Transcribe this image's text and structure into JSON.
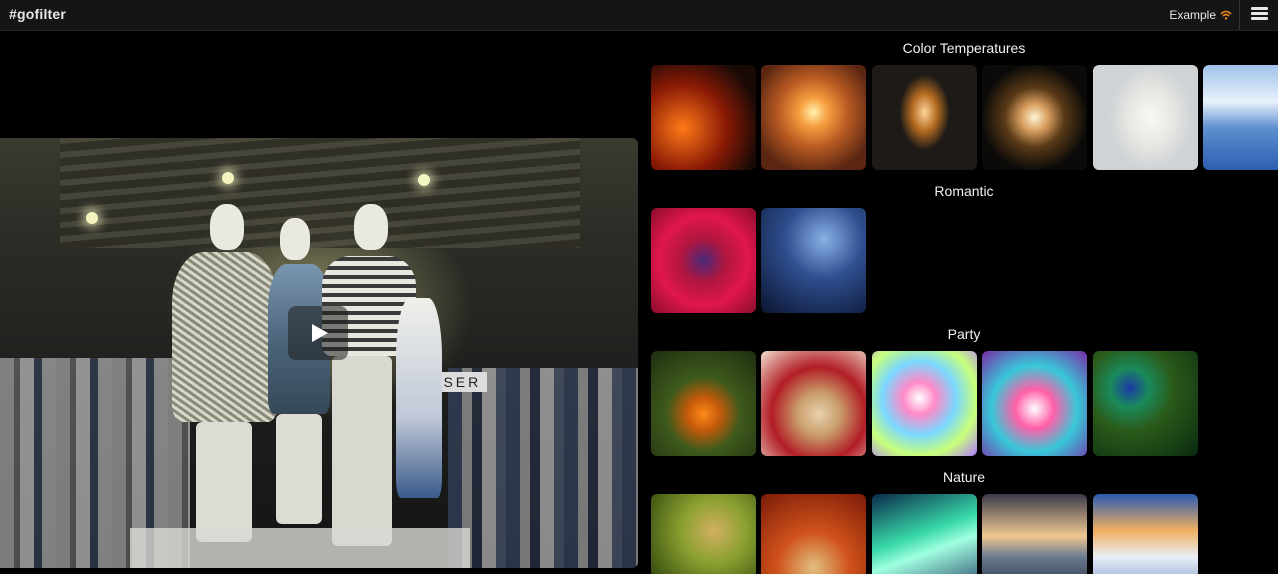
{
  "header": {
    "brand": "#gofilter",
    "example_label": "Example",
    "wifi_icon": "wifi-icon",
    "menu_icon": "hamburger-menu-icon"
  },
  "video": {
    "sign_text": "RESER",
    "play_icon": "play-icon"
  },
  "sections": [
    {
      "title": "Color Temperatures",
      "thumbs": [
        {
          "name": "embers",
          "bg": "radial-gradient(circle at 30% 60%, #ff7a1a, #8a1a05 45%, #1a0a06 80%)"
        },
        {
          "name": "candle",
          "bg": "radial-gradient(circle at 50% 45%, #fff2b0 0%, #f7a040 18%, #b85a22 45%, #5a2612 80%)"
        },
        {
          "name": "lightbulb",
          "bg": "radial-gradient(ellipse 30% 45% at 50% 45%, #ffd59a 0%, #b36a20 40%, #1d1a17 80%)"
        },
        {
          "name": "lamp",
          "bg": "radial-gradient(circle at 50% 50%, #fff3d6 0%, #d9a060 18%, #5a3a18 40%, #0b0a08 72%)"
        },
        {
          "name": "snow-portrait",
          "bg": "radial-gradient(ellipse 40% 50% at 55% 50%, #f8f8f5 0%, #e9e8e3 50%, #cfd3d6 100%)"
        },
        {
          "name": "sky",
          "bg": "linear-gradient(180deg, #9fc2ea 0%, #e9f1fb 35%, #5d8fd0 60%, #2c5fb0 100%)"
        }
      ]
    },
    {
      "title": "Romantic",
      "thumbs": [
        {
          "name": "heart",
          "bg": "radial-gradient(circle at 50% 50%, #4a2a7a 0%, #b1163f 30%, #e0164e 60%, #8a0c2a 100%)"
        },
        {
          "name": "couple-silhouette",
          "bg": "radial-gradient(circle at 60% 30%, #8ab0e6 0%, #2f4f8f 40%, #0b1430 100%)"
        }
      ]
    },
    {
      "title": "Party",
      "thumbs": [
        {
          "name": "pumpkin",
          "bg": "radial-gradient(circle at 50% 60%, #ff8a1a 0%, #c45a0a 20%, #3e5a1c 45%, #1e2e10 100%)"
        },
        {
          "name": "cookies",
          "bg": "radial-gradient(circle at 55% 60%, #e8d2b0 0%, #c99d6a 25%, #b21d26 55%, #f0e0d0 100%)"
        },
        {
          "name": "colorful-droplets",
          "bg": "radial-gradient(circle at 45% 45%, #ffffff 0%, #ff8ac8 20%, #7ad8ff 45%, #c8ff7a 70%, #b07aff 100%)"
        },
        {
          "name": "pink-droplets",
          "bg": "radial-gradient(circle at 50% 55%, #ffffff 0%, #ff5fa8 25%, #38c8d8 55%, #7a2aa8 100%)"
        },
        {
          "name": "peacock",
          "bg": "radial-gradient(circle at 35% 35%, #1b3aa8 0%, #1a8a5a 20%, #2b5a1a 45%, #0a2a10 100%)"
        }
      ]
    },
    {
      "title": "Nature",
      "thumbs": [
        {
          "name": "moss",
          "bg": "radial-gradient(circle at 60% 35%, #d2b060 0%, #8aa030 35%, #3a5010 80%)"
        },
        {
          "name": "autumn-path",
          "bg": "radial-gradient(circle at 50% 70%, #e0c080 0%, #d0521a 40%, #7a1a08 100%)"
        },
        {
          "name": "aurora",
          "bg": "linear-gradient(160deg, #0a2a4a 0%, #38d8a8 40%, #a0ffe0 55%, #1a2a5a 100%)"
        },
        {
          "name": "sea-sunset",
          "bg": "linear-gradient(180deg, #3a3a4a 0%, #f0c890 40%, #6a7a90 60%, #1a2030 100%)"
        },
        {
          "name": "snowy-mountain",
          "bg": "linear-gradient(180deg, #2a5ab0 0%, #f0b060 35%, #e8eef8 60%, #6a8ac0 100%)"
        }
      ]
    }
  ]
}
